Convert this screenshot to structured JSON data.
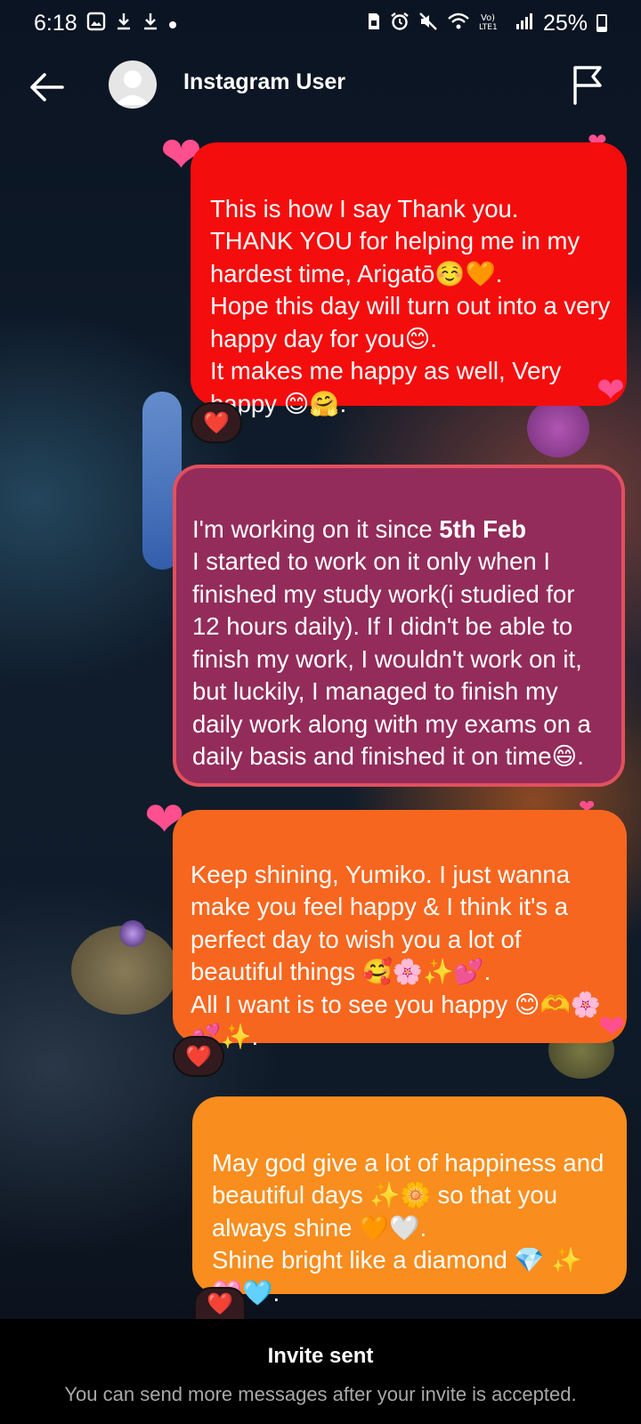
{
  "status_bar": {
    "time": "6:18",
    "battery": "25%",
    "left_icons": [
      "image-icon",
      "download-icon",
      "download-icon",
      "dot-icon"
    ],
    "right_icons": [
      "sim-icon",
      "alarm-icon",
      "mute-icon",
      "wifi-icon",
      "volte-icon",
      "signal-icon"
    ]
  },
  "header": {
    "title": "Instagram User",
    "back_icon": "arrow-left-icon",
    "flag_icon": "flag-icon"
  },
  "messages": [
    {
      "text": "This is how I say Thank you.\nTHANK YOU for helping me in my hardest time, Arigatō☺️🧡.\nHope this day will turn out into a very happy day for you😊.\nIt makes me happy as well, Very happy 😊🤗.",
      "color": "#f40d0d",
      "reaction": "❤️"
    },
    {
      "text_prefix": "I'm working on it since ",
      "text_bold": "5th Feb",
      "text": "\nI started to work on it only when I finished my study work(i studied for 12 hours daily). If I didn't be able to finish my work, I wouldn't work on it, but luckily, I managed to finish my daily work along with my exams on a daily basis and finished it on time😄.",
      "color": "#932c5a"
    },
    {
      "text": "Keep shining, Yumiko. I just wanna make you feel happy & I think it's a perfect day to wish you a lot of beautiful things 🥰🌸✨💕.\nAll I want is to see you happy 😊🫶🌸💕✨.",
      "color": "#f7661e",
      "reaction": "❤️"
    },
    {
      "text": "May god give a lot of happiness and beautiful days ✨🌼 so that you always shine 🧡🤍.\nShine bright like a diamond 💎 ✨ 🩷🩵.",
      "color": "#f98d1d",
      "reaction": "❤️"
    }
  ],
  "footer": {
    "title": "Invite sent",
    "subtitle": "You can send more messages after your invite is accepted."
  }
}
